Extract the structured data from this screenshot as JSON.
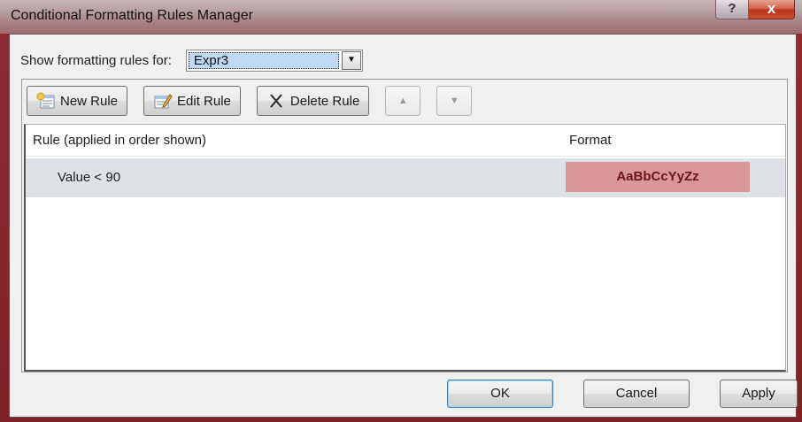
{
  "window": {
    "title": "Conditional Formatting Rules Manager",
    "help_label": "?",
    "close_label": "x"
  },
  "show_rules": {
    "label": "Show formatting rules for:",
    "selected": "Expr3"
  },
  "toolbar": {
    "new_rule": "New Rule",
    "edit_rule": "Edit Rule",
    "delete_rule": "Delete Rule",
    "move_up_label": "▲",
    "move_down_label": "▼"
  },
  "rules_list": {
    "columns": {
      "rule": "Rule (applied in order shown)",
      "format": "Format"
    },
    "rows": [
      {
        "rule": "Value < 90",
        "format_preview": "AaBbCcYyZz",
        "preview_bg": "#d99797",
        "preview_fg": "#6e1616"
      }
    ]
  },
  "buttons": {
    "ok": "OK",
    "cancel": "Cancel",
    "apply": "Apply"
  },
  "icons": {
    "new_rule": "new-rule-icon",
    "edit_rule": "edit-rule-icon",
    "delete_rule": "delete-x-icon"
  },
  "colors": {
    "window_frame": "#9d2f33",
    "selection": "#bfd8f4",
    "row_highlight": "#dee1e6"
  }
}
